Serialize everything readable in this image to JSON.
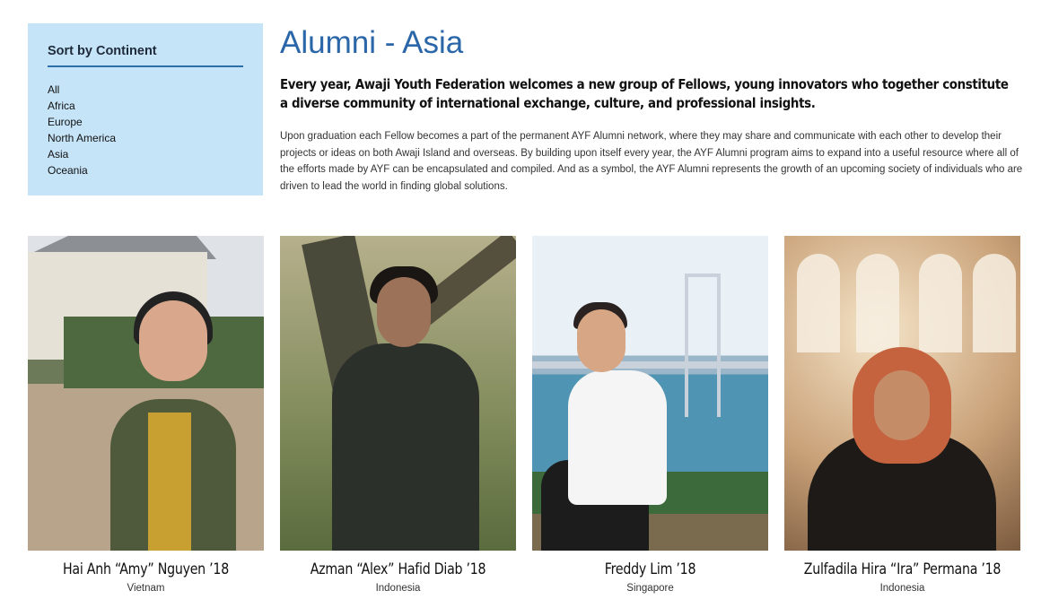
{
  "sidebar": {
    "title": "Sort by Continent",
    "items": [
      "All",
      "Africa",
      "Europe",
      "North America",
      "Asia",
      "Oceania"
    ]
  },
  "main": {
    "title": "Alumni - Asia",
    "lead": "Every year, Awaji Youth Federation welcomes a new group of Fellows, young innovators who together constitute a diverse community of international exchange, culture, and professional insights.",
    "body": "Upon graduation each Fellow becomes a part of the permanent AYF Alumni network, where they may share and communicate with each other to develop their projects or ideas on both Awaji Island and overseas. By building upon itself every year, the AYF Alumni program aims to expand into a useful resource where all of the efforts made by AYF can be encapsulated and compiled. And as a symbol, the AYF Alumni represents the growth of an upcoming society of individuals who are driven to lead the world in finding global solutions."
  },
  "alumni": [
    {
      "name": "Hai Anh “Amy” Nguyen ’18",
      "country": "Vietnam"
    },
    {
      "name": "Azman “Alex” Hafid Diab ’18",
      "country": "Indonesia"
    },
    {
      "name": "Freddy Lim ’18",
      "country": "Singapore"
    },
    {
      "name": "Zulfadila Hira “Ira” Permana ’18",
      "country": "Indonesia"
    }
  ],
  "colors": {
    "sidebar_bg": "#c6e4f8",
    "title": "#2a66a8",
    "underline": "#2b6ea9"
  }
}
